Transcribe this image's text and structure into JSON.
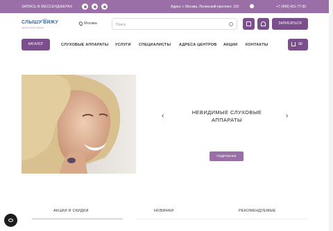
{
  "topbar": {
    "messenger_text": "Запись в мессенджерах",
    "address": "Адрес:  г. Москва, Ленинский проспект, 150",
    "phone": "+7 (499) 431-77-30"
  },
  "header": {
    "logo_text": "СЛЫШУ ВИЖУ",
    "logo_sub": "центры слуха и зрения",
    "city": "Москва",
    "search_placeholder": "Поиск",
    "signup_label": "Записаться"
  },
  "nav": {
    "catalog_label": "Каталог",
    "items": [
      "Слуховые аппараты",
      "Услуги",
      "Специалисты",
      "Адреса центров",
      "Акции",
      "Контакты"
    ],
    "cart_count": "0₽"
  },
  "hero": {
    "title": "Невидимые слуховые аппараты",
    "more_label": "Подробнее",
    "prev": "‹",
    "next": "›"
  },
  "tabs": [
    "Акции и скидки",
    "Новинки",
    "Рекомендуемые"
  ],
  "colors": {
    "brand": "#7b4e8c",
    "topbar": "#9a6fa8"
  }
}
